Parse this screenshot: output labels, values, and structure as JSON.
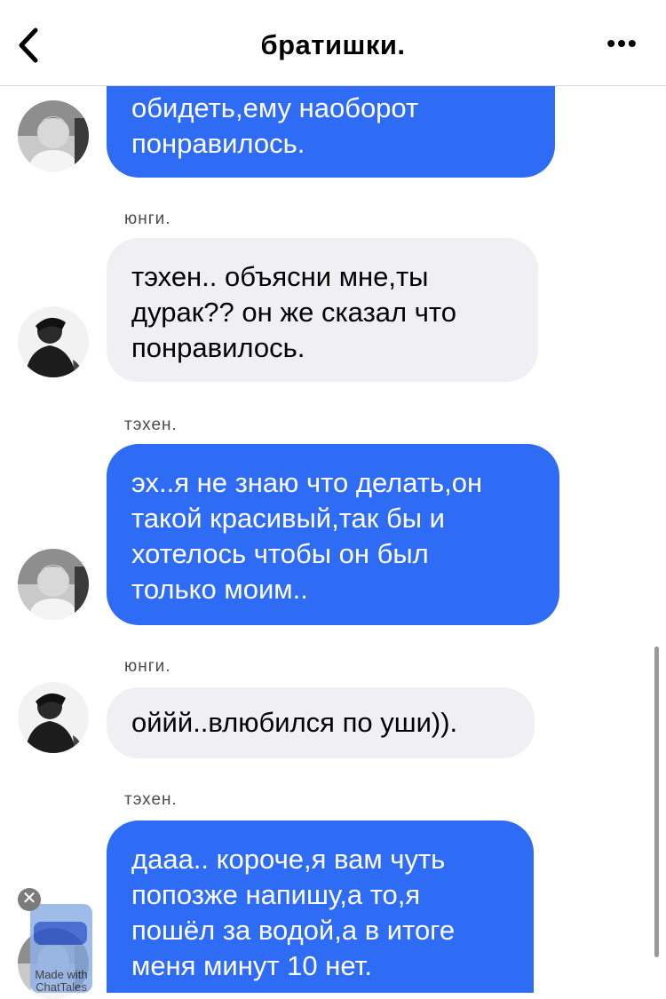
{
  "header": {
    "title": "братишки.",
    "back_icon": "chevron-left-icon",
    "more_icon": "ellipsis-icon",
    "more_label": "•••"
  },
  "messages": [
    {
      "sender": "",
      "bubble": "blue",
      "lines": [
        "обидеть,ему наоборот",
        "понравилось."
      ]
    },
    {
      "sender": "юнги.",
      "bubble": "gray",
      "lines": [
        "тэхен.. объясни мне,ты",
        "дурак?? он же сказал что",
        "понравилось."
      ]
    },
    {
      "sender": "тэхен.",
      "bubble": "blue",
      "lines": [
        "эх..я не знаю что делать,он",
        "такой красивый,так бы и",
        "хотелось чтобы он был",
        "только моим.."
      ]
    },
    {
      "sender": "юнги.",
      "bubble": "gray",
      "lines": [
        "оййй..влюбился по уши))."
      ]
    },
    {
      "sender": "тэхен.",
      "bubble": "blue",
      "lines": [
        "дааа.. короче,я вам чуть",
        "попозже напишу,а то,я",
        "пошёл за водой,а в итоге",
        "меня минут 10 нет."
      ]
    }
  ],
  "watermark": {
    "text": "Made with ChatTales",
    "close_icon": "close-icon",
    "close_label": "✕"
  },
  "colors": {
    "blue_bubble": "#2f6cf5",
    "gray_bubble": "#efeff4",
    "header_bg": "#ffffff"
  }
}
